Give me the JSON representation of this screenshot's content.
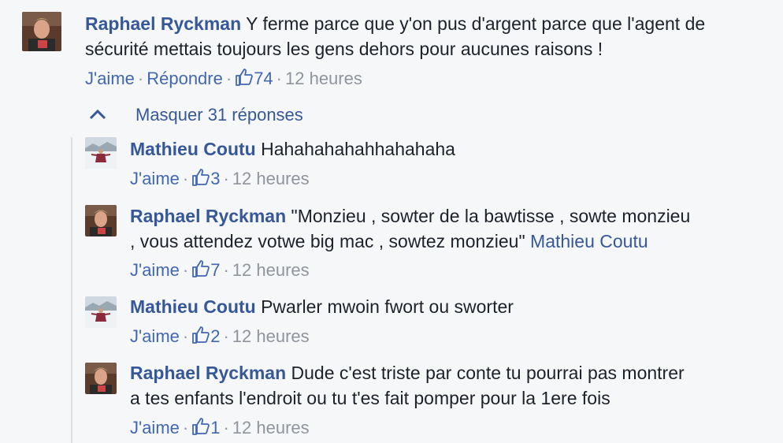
{
  "top_comment": {
    "author": "Raphael Ryckman",
    "text_line1": "Y ferme parce que y'on pus d'argent parce que l'agent de",
    "text_line2": "sécurité mettais toujours les gens dehors pour aucunes raisons !",
    "like_label": "J'aime",
    "reply_label": "Répondre",
    "likes": "74",
    "time": "12 heures"
  },
  "toggle": {
    "label": "Masquer 31 réponses"
  },
  "replies": [
    {
      "author": "Mathieu Coutu",
      "text_line1": "Hahahahahahhahahaha",
      "like_label": "J'aime",
      "likes": "3",
      "time": "12 heures"
    },
    {
      "author": "Raphael Ryckman",
      "text_line1": "\"Monzieu , sowter de la bawtisse , sowte monzieu",
      "text_line2": ", vous attendez votwe big mac , sowtez monzieu\"",
      "mention": "Mathieu Coutu",
      "like_label": "J'aime",
      "likes": "7",
      "time": "12 heures"
    },
    {
      "author": "Mathieu Coutu",
      "text_line1": "Pwarler mwoin fwort ou sworter",
      "like_label": "J'aime",
      "likes": "2",
      "time": "12 heures"
    },
    {
      "author": "Raphael Ryckman",
      "text_line1": "Dude c'est triste par conte tu pourrai pas montrer",
      "text_line2": "a tes enfants l'endroit ou tu t'es fait pomper pour la 1ere fois",
      "like_label": "J'aime",
      "likes": "1",
      "time": "12 heures"
    }
  ],
  "colors": {
    "author": "#365899",
    "link": "#4267b2",
    "meta": "#90949c",
    "background": "#f6f7f9"
  },
  "icons": {
    "like": "thumbs-up-icon",
    "toggle": "chevron-up-icon"
  }
}
